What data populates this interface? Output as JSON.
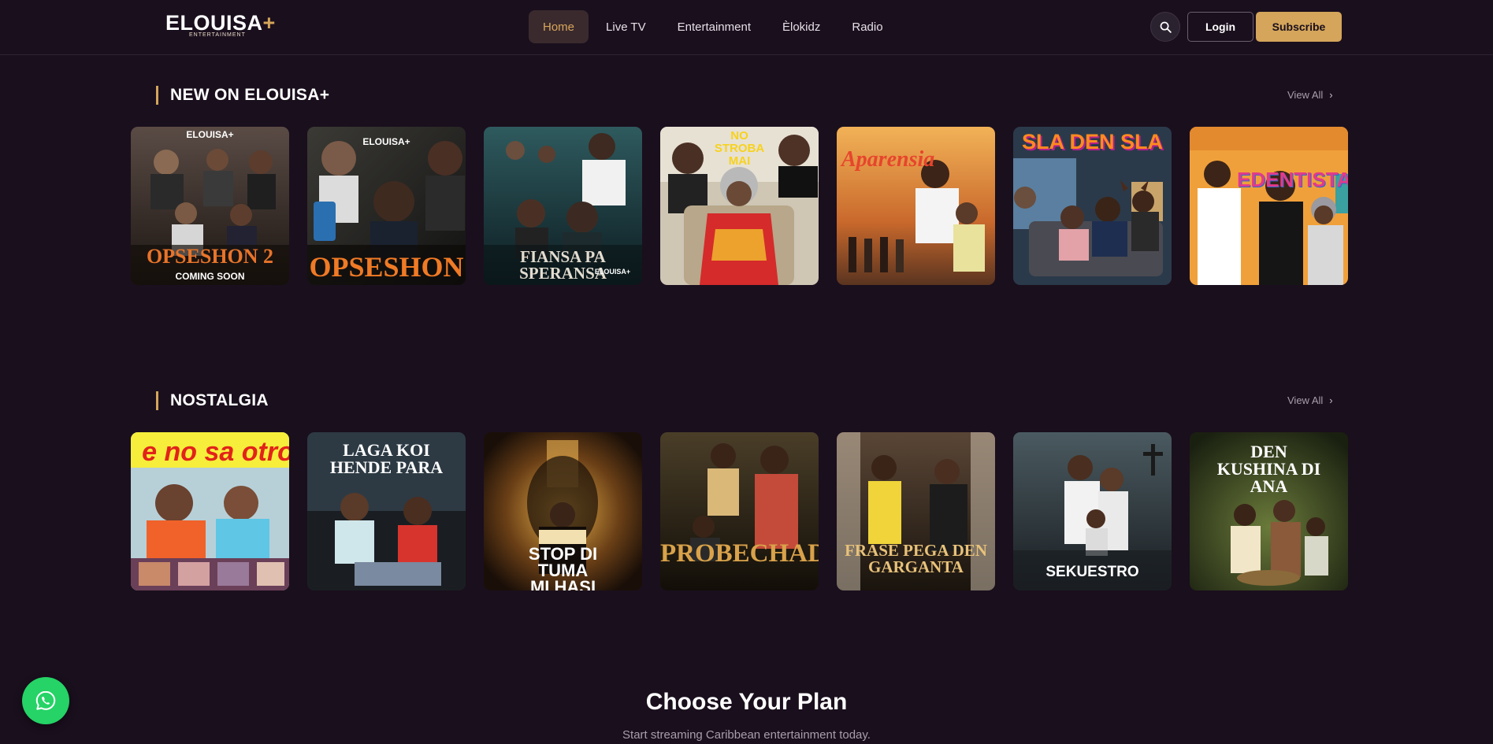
{
  "brand": {
    "name": "ELOUISA",
    "plus": "+",
    "tagline": "ENTERTAINMENT"
  },
  "nav": [
    {
      "label": "Home",
      "active": true
    },
    {
      "label": "Live TV",
      "active": false
    },
    {
      "label": "Entertainment",
      "active": false
    },
    {
      "label": "Èlokidz",
      "active": false
    },
    {
      "label": "Radio",
      "active": false
    }
  ],
  "header": {
    "search_icon": "search-icon",
    "login_label": "Login",
    "subscribe_label": "Subscribe"
  },
  "colors": {
    "background": "#1a0f1d",
    "accent": "#d4a55a",
    "whatsapp": "#25d366"
  },
  "sections": [
    {
      "title": "NEW ON ELOUISA+",
      "view_all": "View All",
      "cards": [
        {
          "title": "OPSESHON 2",
          "subtitle": "COMING SOON",
          "badge": "ELOUISA+"
        },
        {
          "title": "OPSESHON",
          "badge": "ELOUISA+"
        },
        {
          "title": "FIANSA PA SPERANSA",
          "badge": "ELOUISA+"
        },
        {
          "title": "NO STROBA MAI"
        },
        {
          "title": "Aparensia"
        },
        {
          "title": "SLA DEN SLA"
        },
        {
          "title": "EDENTISTA"
        }
      ]
    },
    {
      "title": "NOSTALGIA",
      "view_all": "View All",
      "cards": [
        {
          "title": "e no sa otro"
        },
        {
          "title": "LAGA KOI HENDE PARA"
        },
        {
          "title": "STOP DI TUMA MI HASI"
        },
        {
          "title": "PROBECHADOR"
        },
        {
          "title": "FRASE PEGA DEN GARGANTA"
        },
        {
          "title": "SEKUESTRO"
        },
        {
          "title": "DEN KUSHINA DI ANA"
        }
      ]
    }
  ],
  "plans": {
    "title": "Choose Your Plan",
    "subtitle": "Start streaming Caribbean entertainment today."
  },
  "floating": {
    "icon": "whatsapp-icon"
  }
}
